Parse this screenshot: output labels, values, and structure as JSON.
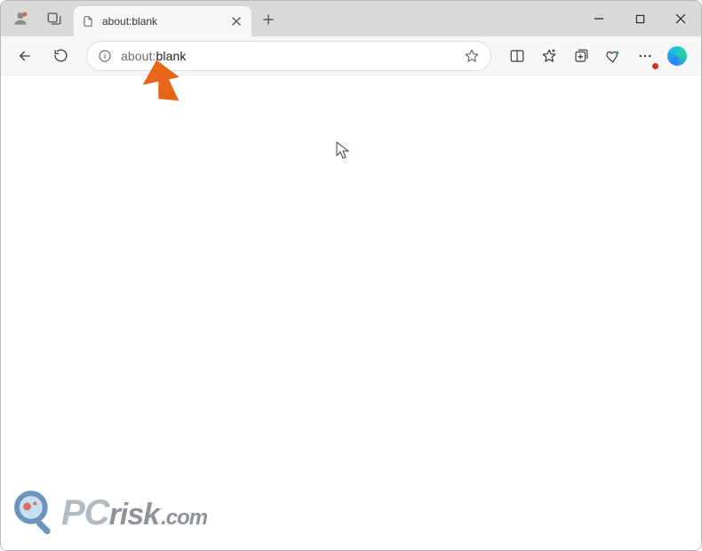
{
  "tab": {
    "title": "about:blank"
  },
  "address": {
    "url_host": "about:",
    "url_path": "blank"
  },
  "watermark": {
    "pc": "PC",
    "risk": "risk",
    "com": ".com"
  }
}
